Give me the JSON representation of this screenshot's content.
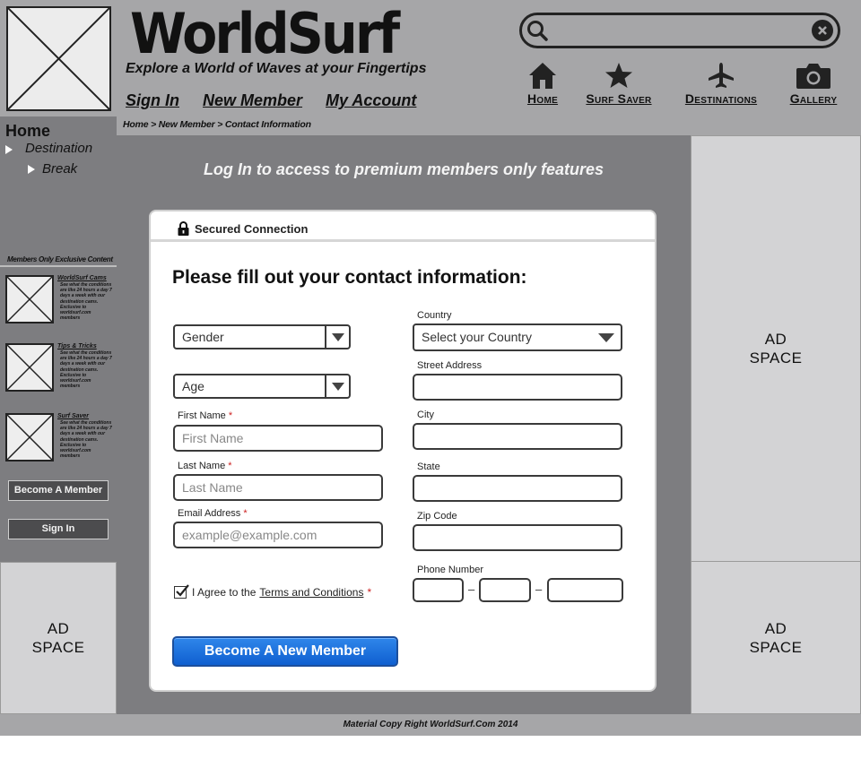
{
  "header": {
    "brand": "WorldSurf",
    "tagline": "Explore a World of Waves at your Fingertips",
    "nav": [
      "Sign In",
      "New Member",
      "My Account"
    ],
    "search_placeholder": "",
    "icon_nav": [
      {
        "label": "Home",
        "icon": "home-icon"
      },
      {
        "label": "Surf Saver",
        "icon": "star-icon"
      },
      {
        "label": "Destinations",
        "icon": "airplane-icon"
      },
      {
        "label": "Gallery",
        "icon": "camera-icon"
      }
    ]
  },
  "breadcrumb": "Home > New Member > Contact Information",
  "sidebar": {
    "home": "Home",
    "destination": "Destination",
    "break": "Break",
    "exclusive_label": "Members Only Exclusive Content",
    "items": [
      {
        "title": "WorldSurf Cams",
        "desc": "See what the conditions are like 24 hours a day 7 days a week with our destination cams. Exclusive to worldsurf.com members"
      },
      {
        "title": "Tips & Tricks",
        "desc": "See what the conditions are like 24 hours a day 7 days a week with our destination cams. Exclusive to worldsurf.com members"
      },
      {
        "title": "Surf Saver",
        "desc": "See what the conditions are like 24 hours a day 7 days a week with our destination cams. Exclusive to worldsurf.com members"
      }
    ],
    "become_member_button": "Become A Member",
    "sign_in_button": "Sign In"
  },
  "ads": {
    "left_bottom": [
      "AD",
      "SPACE"
    ],
    "right_top": [
      "AD",
      "SPACE"
    ],
    "right_bottom": [
      "AD",
      "SPACE"
    ]
  },
  "main": {
    "login_message": "Log In to access to premium members only features",
    "secure_label": "Secured Connection",
    "form_title": "Please fill out your contact information:",
    "gender_select": "Gender",
    "age_select": "Age",
    "first_name_label": "First Name",
    "first_name_placeholder": "First Name",
    "last_name_label": "Last Name",
    "last_name_placeholder": "Last Name",
    "email_label": "Email Address",
    "email_placeholder": "example@example.com",
    "country_label": "Country",
    "country_select": "Select your Country",
    "street_label": "Street Address",
    "city_label": "City",
    "state_label": "State",
    "zip_label": "Zip Code",
    "phone_label": "Phone Number",
    "phone_sep": "–",
    "required_mark": "*",
    "agree_text": "I Agree to the",
    "terms_text": "Terms and Conditions",
    "agree_checked": true,
    "submit_button": "Become A New Member"
  },
  "footer": "Material Copy Right WorldSurf.Com 2014",
  "colors": {
    "header_bg": "#a6a6a8",
    "panel_bg": "#7d7d80",
    "ad_bg": "#d3d3d5",
    "button_blue": "#0f5fd0",
    "required_red": "#cc1f1f"
  }
}
